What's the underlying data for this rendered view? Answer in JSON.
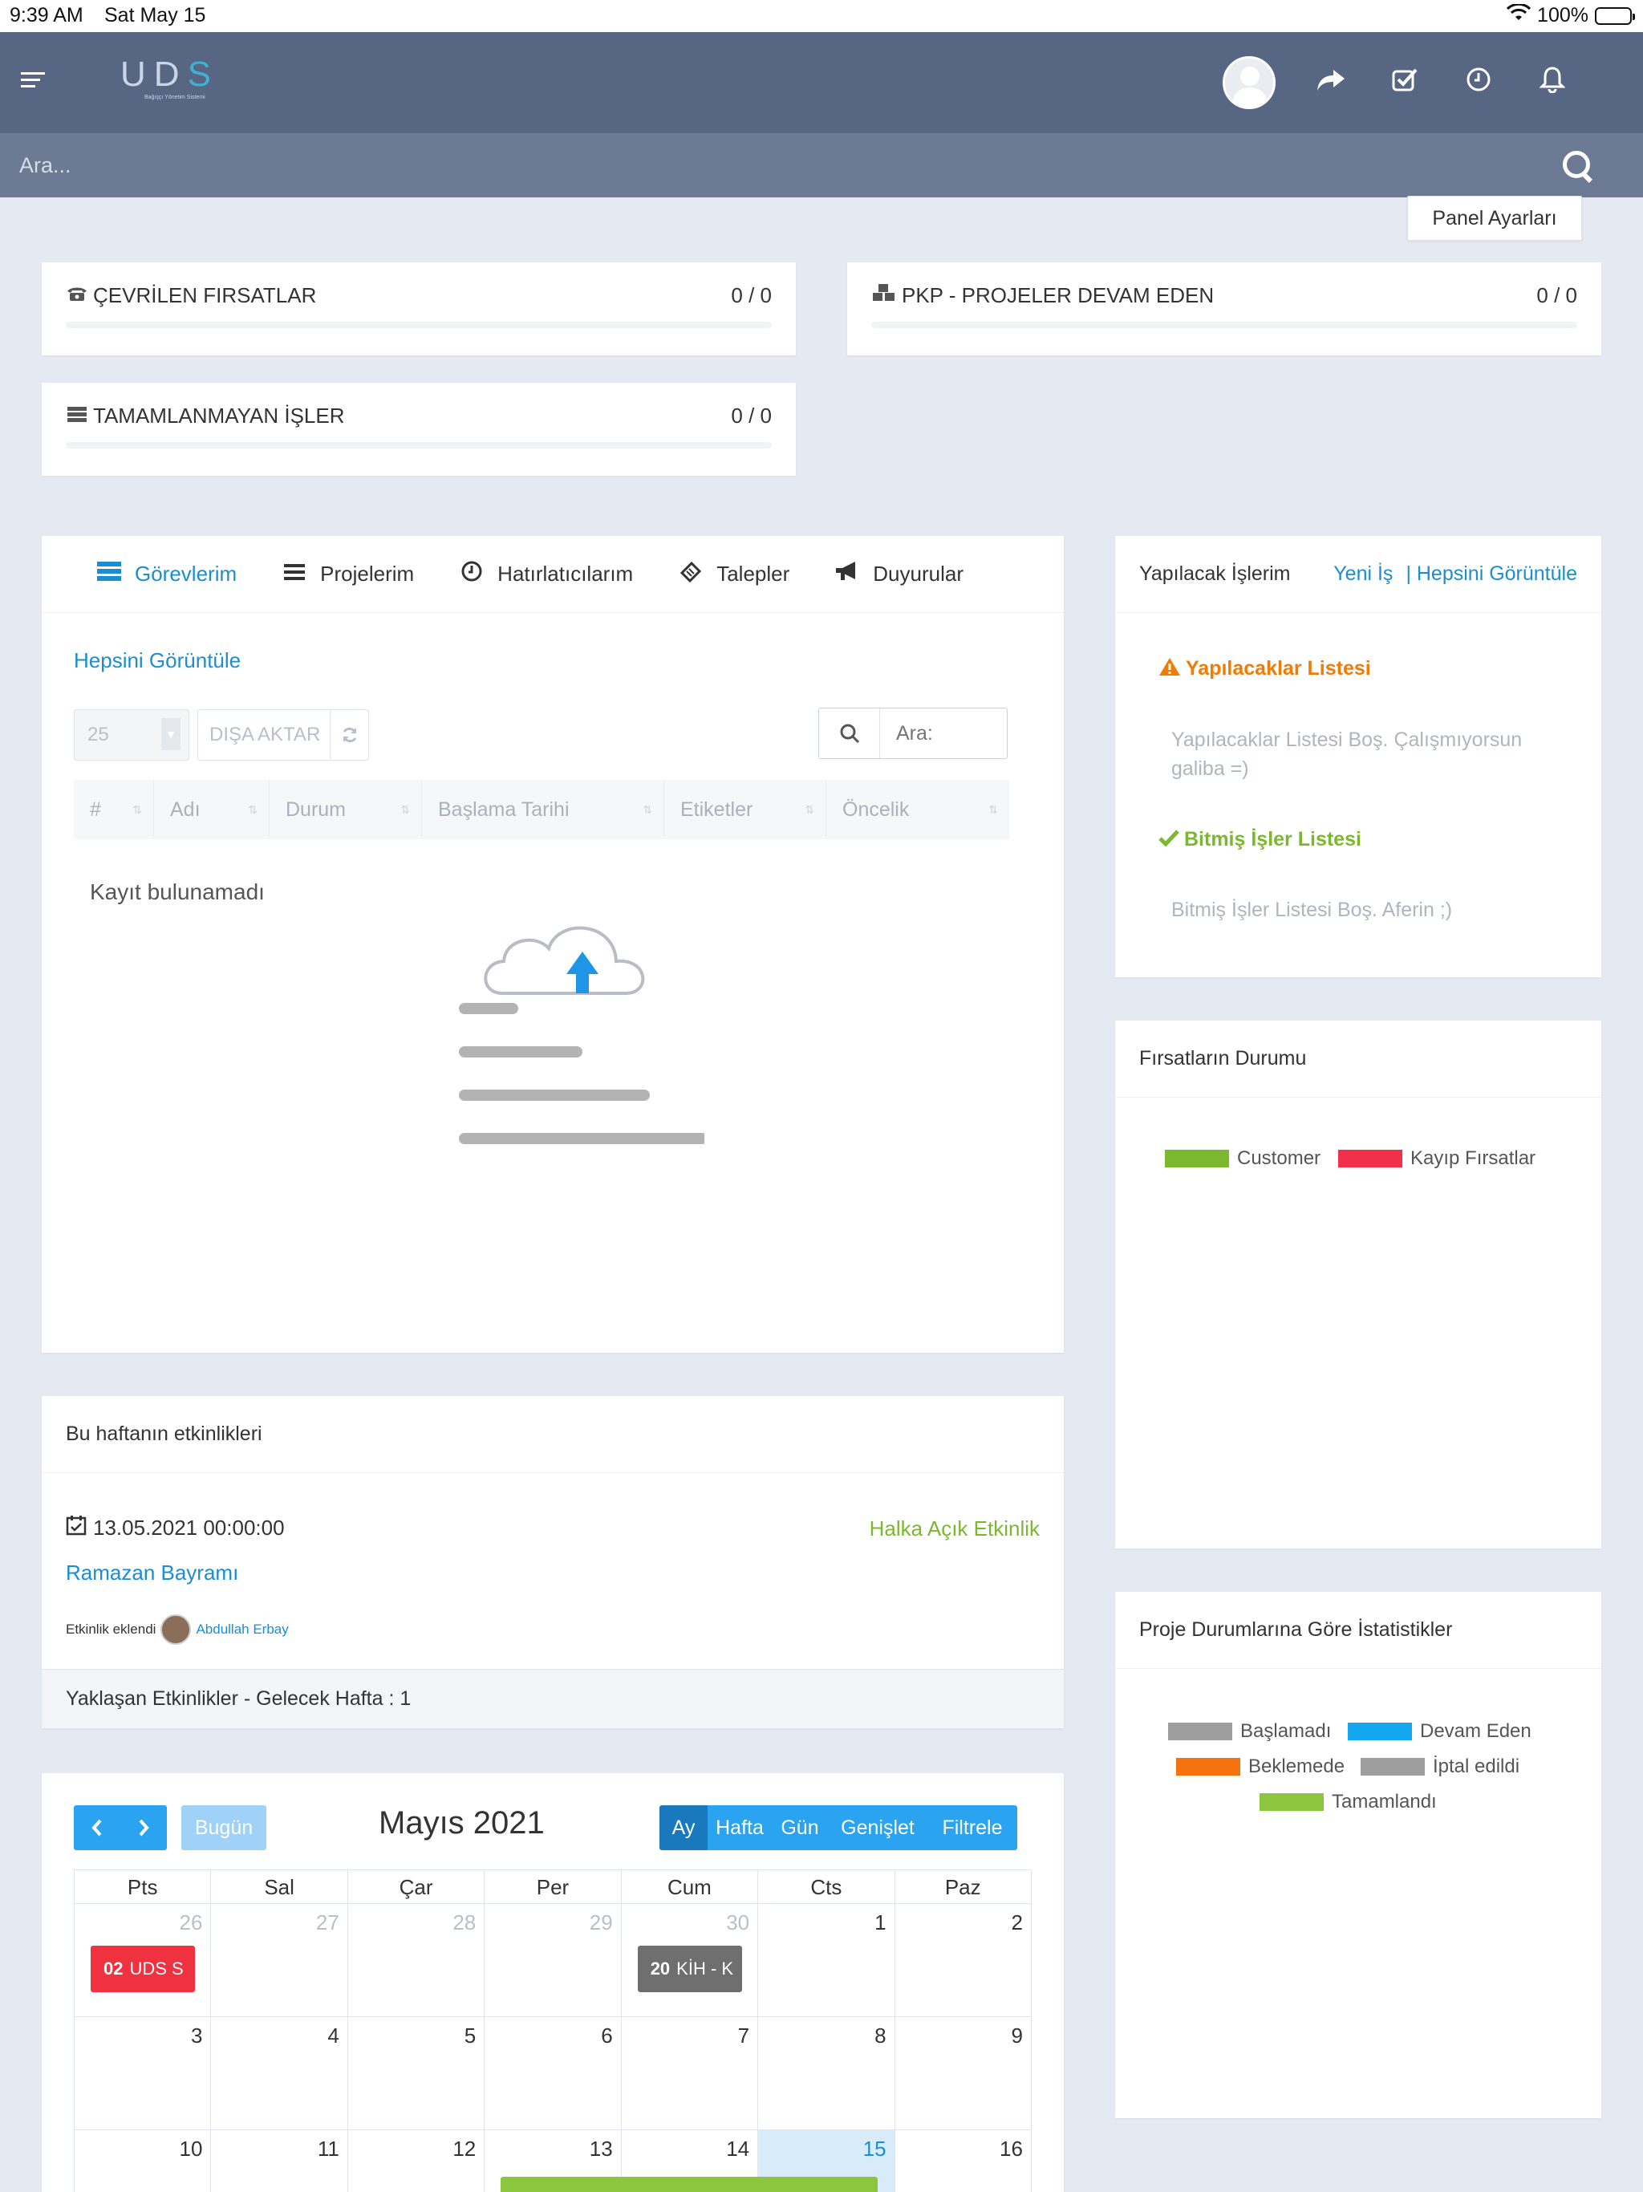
{
  "status_bar": {
    "time": "9:39 AM",
    "date": "Sat May 15",
    "battery": "100%"
  },
  "header": {
    "logo_main": "UD",
    "logo_accent": "S",
    "logo_tagline": "Bağışçı Yönetim Sistemi"
  },
  "search": {
    "placeholder": "Ara..."
  },
  "panel_settings": "Panel Ayarları",
  "stats": [
    {
      "title": "ÇEVRİLEN FIRSATLAR",
      "count": "0 / 0"
    },
    {
      "title": "PKP - PROJELER DEVAM EDEN",
      "count": "0 / 0"
    },
    {
      "title": "TAMAMLANMAYAN İŞLER",
      "count": "0 / 0"
    }
  ],
  "tasks": {
    "tabs": [
      "Görevlerim",
      "Projelerim",
      "Hatırlatıcılarım",
      "Talepler",
      "Duyurular"
    ],
    "view_all": "Hepsini Görüntüle",
    "page_size": "25",
    "export": "DIŞA AKTAR",
    "search_placeholder": "Ara:",
    "columns": [
      "#",
      "Adı",
      "Durum",
      "Başlama Tarihi",
      "Etiketler",
      "Öncelik"
    ],
    "empty": "Kayıt bulunamadı"
  },
  "todo": {
    "title": "Yapılacak İşlerim",
    "new": "Yeni İş",
    "view_all": "| Hepsini Görüntüle",
    "todo_list_title": "Yapılacaklar Listesi",
    "todo_empty": "Yapılacaklar Listesi Boş. Çalışmıyorsun galiba =)",
    "done_list_title": "Bitmiş İşler Listesi",
    "done_empty": "Bitmiş İşler Listesi Boş. Aferin ;)"
  },
  "opportunities": {
    "title": "Fırsatların Durumu",
    "legend": [
      {
        "label": "Customer",
        "color": "#7cb82f"
      },
      {
        "label": "Kayıp Fırsatlar",
        "color": "#f1304b"
      }
    ]
  },
  "events": {
    "title": "Bu haftanın etkinlikleri",
    "date": "13.05.2021 00:00:00",
    "type": "Halka Açık Etkinlik",
    "name": "Ramazan Bayramı",
    "added_by_label": "Etkinlik eklendi",
    "added_by": "Abdullah Erbay",
    "upcoming": "Yaklaşan Etkinlikler - Gelecek Hafta : 1"
  },
  "project_stats": {
    "title": "Proje Durumlarına Göre İstatistikler",
    "legend": [
      {
        "label": "Başlamadı",
        "color": "#9e9e9e"
      },
      {
        "label": "Devam Eden",
        "color": "#13a7f0"
      },
      {
        "label": "Beklemede",
        "color": "#f5730f"
      },
      {
        "label": "İptal edildi",
        "color": "#9e9e9e"
      },
      {
        "label": "Tamamlandı",
        "color": "#8cc63e"
      }
    ]
  },
  "calendar": {
    "title": "Mayıs 2021",
    "today_btn": "Bugün",
    "views": [
      "Ay",
      "Hafta",
      "Gün",
      "Genişlet",
      "Filtrele"
    ],
    "weekdays": [
      "Pts",
      "Sal",
      "Çar",
      "Per",
      "Cum",
      "Cts",
      "Paz"
    ],
    "weeks": [
      [
        "26",
        "27",
        "28",
        "29",
        "30",
        "1",
        "2"
      ],
      [
        "3",
        "4",
        "5",
        "6",
        "7",
        "8",
        "9"
      ],
      [
        "10",
        "11",
        "12",
        "13",
        "14",
        "15",
        "16"
      ]
    ],
    "events": [
      {
        "time": "02",
        "title": "UDS S",
        "color": "#f0313f"
      },
      {
        "time": "20",
        "title": "KİH - K",
        "color": "#6f6f6f"
      }
    ]
  }
}
